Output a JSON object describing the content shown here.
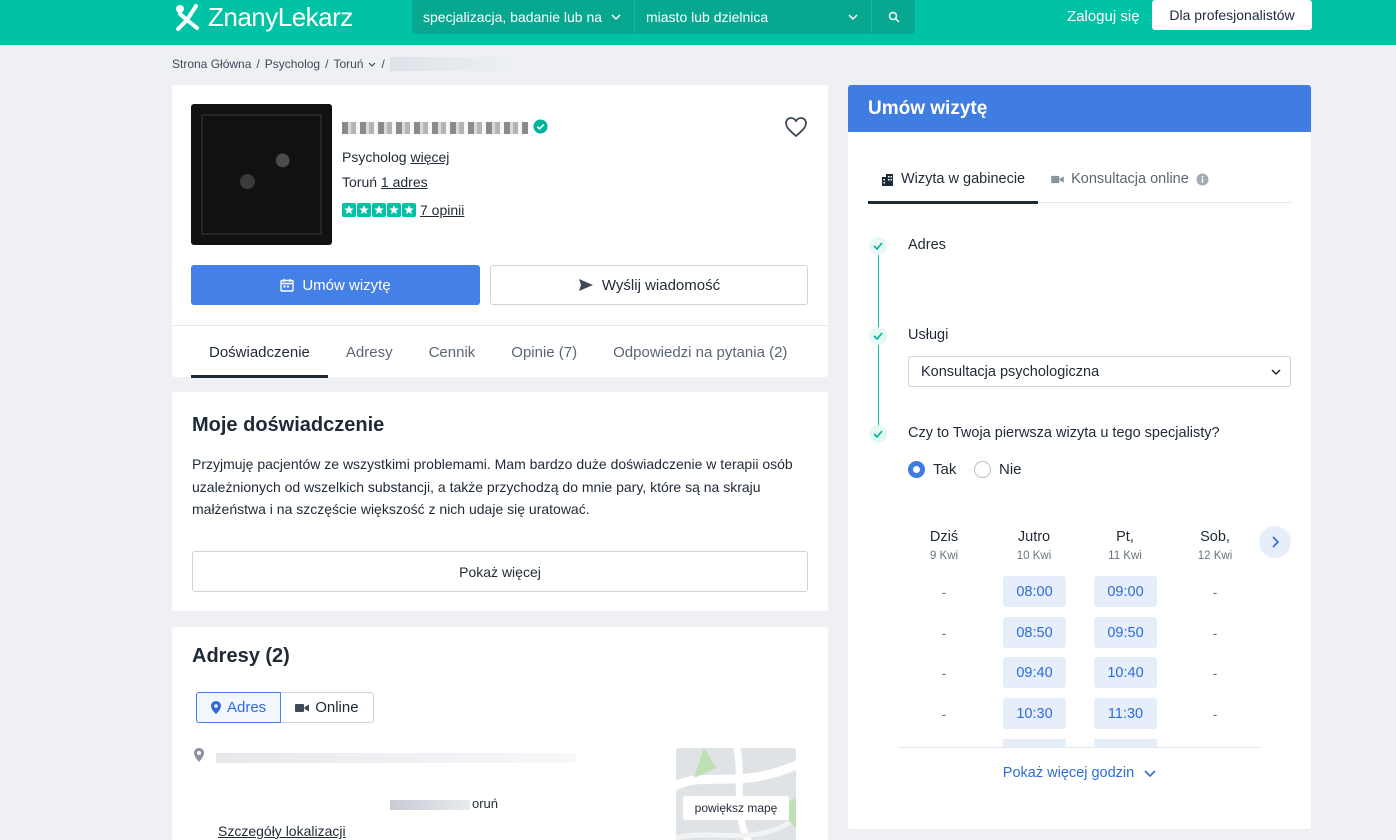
{
  "header": {
    "logo_text": "ZnanyLekarz",
    "search_specialization_placeholder": "specjalizacja, badanie lub na",
    "search_city_placeholder": "miasto lub dzielnica",
    "login_label": "Zaloguj się",
    "pro_button_label": "Dla profesjonalistów",
    "brand_color": "#00c3a5"
  },
  "breadcrumb": {
    "items": [
      "Strona Główna",
      "Psycholog",
      "Toruń"
    ]
  },
  "profile": {
    "specialty": "Psycholog",
    "specialty_more_link": "więcej",
    "city": "Toruń",
    "address_link": "1 adres",
    "rating_stars": 5,
    "reviews_link": "7 opinii",
    "book_button": "Umów wizytę",
    "message_button": "Wyślij wiadomość",
    "tabs": [
      "Doświadczenie",
      "Adresy",
      "Cennik",
      "Opinie (7)",
      "Odpowiedzi na pytania (2)"
    ],
    "active_tab": "Doświadczenie"
  },
  "experience": {
    "title": "Moje doświadczenie",
    "text": "Przyjmuję pacjentów ze wszystkimi problemami. Mam bardzo duże doświadczenie w terapii osób uzależnionych od wszelkich substancji, a także przychodzą do mnie pary, które są na skraju małżeństwa i na szczęście większość z nich udaje się uratować.",
    "show_more": "Pokaż więcej"
  },
  "addresses": {
    "title": "Adresy (2)",
    "toggle_address": "Adres",
    "toggle_online": "Online",
    "city_suffix": "oruń",
    "location_details_link": "Szczegóły lokalizacji",
    "map_button": "powiększ mapę"
  },
  "booking": {
    "title": "Umów wizytę",
    "tab_office": "Wizyta w gabinecie",
    "tab_online": "Konsultacja online",
    "step_address": "Adres",
    "step_services": "Usługi",
    "service_selected": "Konsultacja psychologiczna",
    "first_visit_question": "Czy to Twoja pierwsza wizyta u tego specjalisty?",
    "option_yes": "Tak",
    "option_no": "Nie",
    "selected_option": "Tak",
    "days": [
      {
        "day": "Dziś",
        "date": "9 Kwi",
        "slots": [
          "-",
          "-",
          "-",
          "-"
        ]
      },
      {
        "day": "Jutro",
        "date": "10 Kwi",
        "slots": [
          "08:00",
          "08:50",
          "09:40",
          "10:30"
        ]
      },
      {
        "day": "Pt,",
        "date": "11 Kwi",
        "slots": [
          "09:00",
          "09:50",
          "10:40",
          "11:30"
        ]
      },
      {
        "day": "Sob,",
        "date": "12 Kwi",
        "slots": [
          "-",
          "-",
          "-",
          "-"
        ]
      }
    ],
    "show_more_hours": "Pokaż więcej godzin",
    "accent_color": "#3f7de3"
  }
}
